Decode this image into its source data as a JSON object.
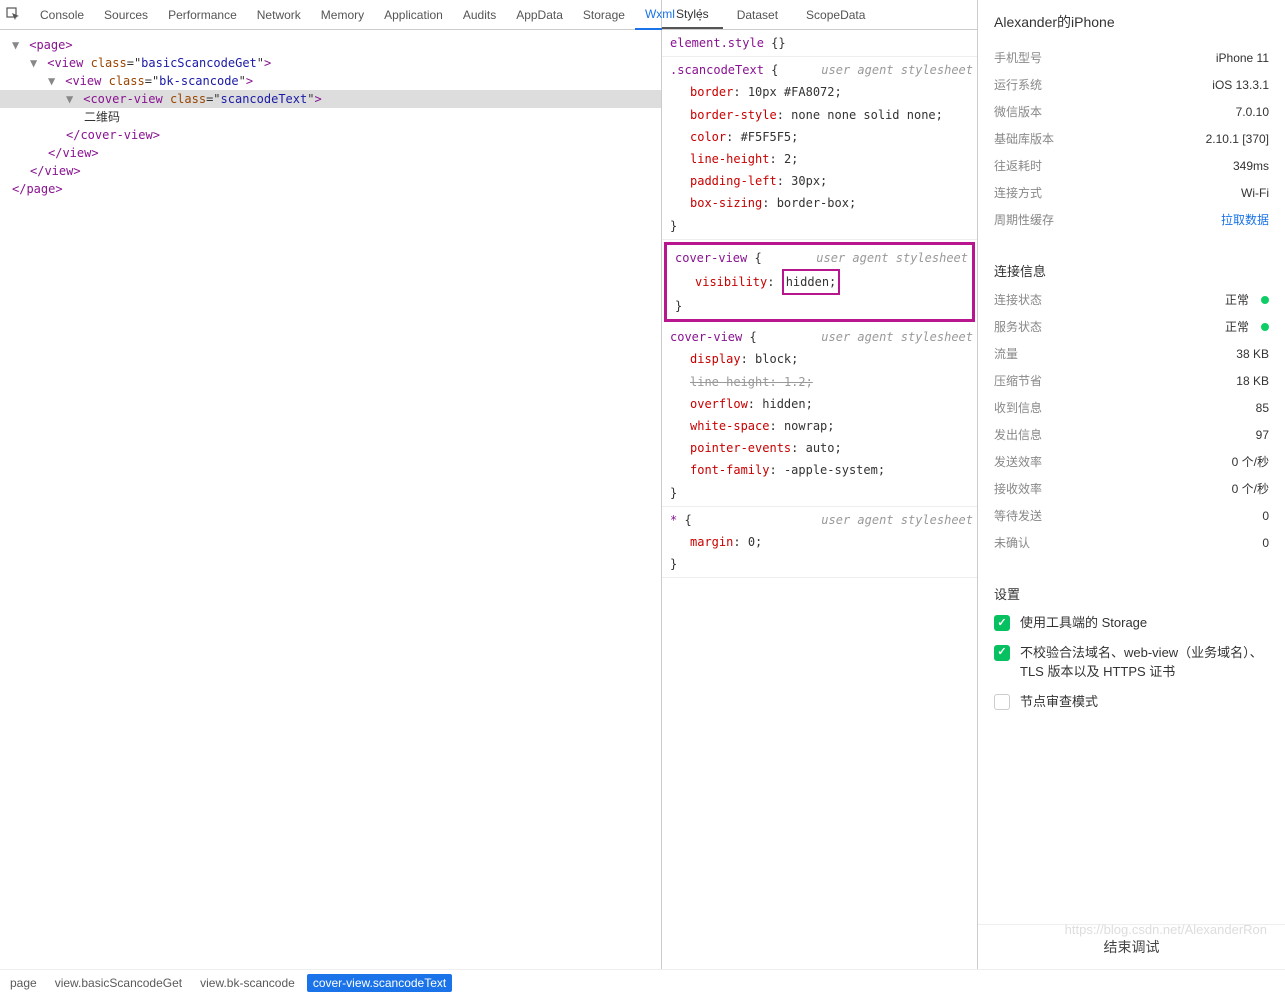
{
  "devtools": {
    "tabs": [
      "Console",
      "Sources",
      "Performance",
      "Network",
      "Memory",
      "Application",
      "Audits",
      "AppData",
      "Storage",
      "Wxml"
    ],
    "activeTab": "Wxml"
  },
  "tree": {
    "lines": [
      {
        "indent": 1,
        "arrow": "▼",
        "open": "<",
        "tag": "page",
        "close": ">"
      },
      {
        "indent": 2,
        "arrow": "▼",
        "open": "<",
        "tag": "view",
        "attr": "class",
        "aval": "basicScancodeGet",
        "close": ">"
      },
      {
        "indent": 3,
        "arrow": "▼",
        "open": "<",
        "tag": "view",
        "attr": "class",
        "aval": "bk-scancode",
        "close": ">"
      },
      {
        "indent": 4,
        "arrow": "▼",
        "open": "<",
        "tag": "cover-view",
        "attr": "class",
        "aval": "scancodeText",
        "close": ">",
        "sel": true
      },
      {
        "indent": 5,
        "text": "二维码"
      },
      {
        "indent": 4,
        "open": "</",
        "tag": "cover-view",
        "close": ">"
      },
      {
        "indent": 3,
        "open": "</",
        "tag": "view",
        "close": ">"
      },
      {
        "indent": 2,
        "open": "</",
        "tag": "view",
        "close": ">"
      },
      {
        "indent": 1,
        "open": "</",
        "tag": "page",
        "close": ">"
      }
    ],
    "breadcrumb": [
      "page",
      "view.basicScancodeGet",
      "view.bk-scancode",
      "cover-view.scancodeText"
    ]
  },
  "stylesTabs": [
    "Styles",
    "Dataset",
    "ScopeData"
  ],
  "stylesActive": "Styles",
  "rules": [
    {
      "selector": "element.style",
      "uas": false,
      "props": []
    },
    {
      "selector": ".scancodeText",
      "uas": true,
      "props": [
        {
          "n": "border",
          "v": "10px #FA8072"
        },
        {
          "n": "border-style",
          "v": "none none solid none"
        },
        {
          "n": "color",
          "v": "#F5F5F5"
        },
        {
          "n": "line-height",
          "v": "2"
        },
        {
          "n": "padding-left",
          "v": "30px"
        },
        {
          "n": "box-sizing",
          "v": "border-box"
        }
      ]
    },
    {
      "selector": "cover-view",
      "uas": true,
      "highlight": true,
      "props": [
        {
          "n": "visibility",
          "v": "hidden",
          "boxed": true
        }
      ]
    },
    {
      "selector": "cover-view",
      "uas": true,
      "props": [
        {
          "n": "display",
          "v": "block"
        },
        {
          "n": "line-height",
          "v": "1.2",
          "strike": true
        },
        {
          "n": "overflow",
          "v": "hidden"
        },
        {
          "n": "white-space",
          "v": "nowrap"
        },
        {
          "n": "pointer-events",
          "v": "auto"
        },
        {
          "n": "font-family",
          "v": "-apple-system"
        }
      ]
    },
    {
      "selector": "*",
      "uas": true,
      "props": [
        {
          "n": "margin",
          "v": "0"
        }
      ]
    }
  ],
  "uasLabel": "user agent stylesheet",
  "device": {
    "title": "Alexander的iPhone",
    "rows": [
      {
        "label": "手机型号",
        "value": "iPhone 11"
      },
      {
        "label": "运行系统",
        "value": "iOS 13.3.1"
      },
      {
        "label": "微信版本",
        "value": "7.0.10"
      },
      {
        "label": "基础库版本",
        "value": "2.10.1 [370]"
      },
      {
        "label": "往返耗时",
        "value": "349ms"
      },
      {
        "label": "连接方式",
        "value": "Wi-Fi"
      },
      {
        "label": "周期性缓存",
        "value": "拉取数据",
        "link": true
      }
    ]
  },
  "conn": {
    "title": "连接信息",
    "rows": [
      {
        "label": "连接状态",
        "value": "正常",
        "dot": true
      },
      {
        "label": "服务状态",
        "value": "正常",
        "dot": true
      },
      {
        "label": "流量",
        "value": "38 KB"
      },
      {
        "label": "压缩节省",
        "value": "18 KB"
      },
      {
        "label": "收到信息",
        "value": "85"
      },
      {
        "label": "发出信息",
        "value": "97"
      },
      {
        "label": "发送效率",
        "value": "0 个/秒"
      },
      {
        "label": "接收效率",
        "value": "0 个/秒"
      },
      {
        "label": "等待发送",
        "value": "0"
      },
      {
        "label": "未确认",
        "value": "0"
      }
    ]
  },
  "settings": {
    "title": "设置",
    "checks": [
      {
        "label": "使用工具端的 Storage",
        "on": true
      },
      {
        "label": "不校验合法域名、web-view（业务域名）、TLS 版本以及 HTTPS 证书",
        "on": true
      },
      {
        "label": "节点审查模式",
        "on": false
      }
    ],
    "footer": "结束调试"
  },
  "watermark": "https://blog.csdn.net/AlexanderRon"
}
